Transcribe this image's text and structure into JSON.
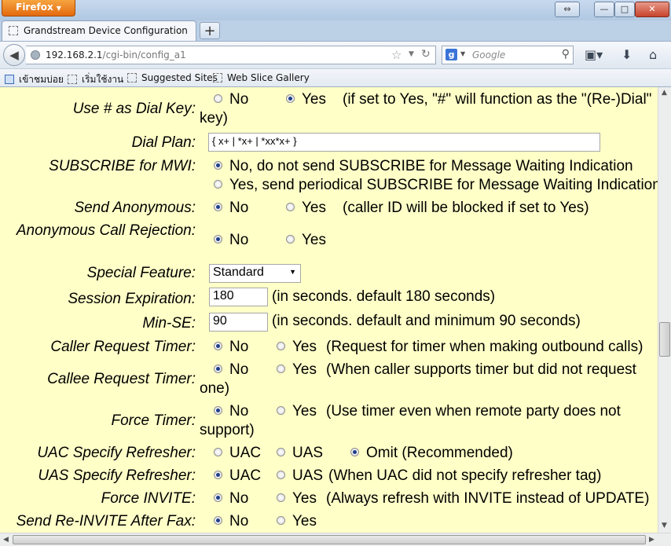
{
  "browser": {
    "menu_button": "Firefox",
    "tab_title": "Grandstream Device Configuration",
    "url_host": "192.168.2.1",
    "url_path": "/cgi-bin/config_a1",
    "search_placeholder": "Google",
    "search_engine_letter": "g",
    "bookmarks": [
      "เข้าชมบ่อย",
      "เริ่มใช้งาน",
      "Suggested Sites",
      "Web Slice Gallery"
    ]
  },
  "settings": {
    "dial_key": {
      "label": "Use # as Dial Key:",
      "opt_no": "No",
      "opt_yes": "Yes",
      "note": "(if set to Yes, \"#\" will function as the \"(Re-)Dial\"",
      "note_cont": "key)",
      "selected": "Yes"
    },
    "dial_plan": {
      "label": "Dial Plan:",
      "value": "{ x+ | *x+ | *xx*x+ }"
    },
    "subscribe_mwi": {
      "label": "SUBSCRIBE for MWI:",
      "opt_no": "No, do not send SUBSCRIBE for Message Waiting Indication",
      "opt_yes": "Yes, send periodical SUBSCRIBE for Message Waiting Indication",
      "selected": "No"
    },
    "send_anonymous": {
      "label": "Send Anonymous:",
      "opt_no": "No",
      "opt_yes": "Yes",
      "note": "(caller ID will be blocked if set to Yes)",
      "selected": "No"
    },
    "anon_rejection": {
      "label": "Anonymous Call Rejection:",
      "opt_no": "No",
      "opt_yes": "Yes",
      "selected": "No"
    },
    "special_feature": {
      "label": "Special Feature:",
      "value": "Standard"
    },
    "session_expiration": {
      "label": "Session Expiration:",
      "value": "180",
      "note": "(in seconds. default 180 seconds)"
    },
    "min_se": {
      "label": "Min-SE:",
      "value": "90",
      "note": "(in seconds. default and minimum 90 seconds)"
    },
    "caller_timer": {
      "label": "Caller Request Timer:",
      "opt_no": "No",
      "opt_yes": "Yes",
      "note": "(Request for timer when making outbound calls)",
      "selected": "No"
    },
    "callee_timer": {
      "label": "Callee Request Timer:",
      "opt_no": "No",
      "opt_yes": "Yes",
      "note": "(When caller supports timer but did not request",
      "note_cont": "one)",
      "selected": "No"
    },
    "force_timer": {
      "label": "Force Timer:",
      "opt_no": "No",
      "opt_yes": "Yes",
      "note": "(Use timer even when remote party does not",
      "note_cont": "support)",
      "selected": "No"
    },
    "uac_refresher": {
      "label": "UAC Specify Refresher:",
      "opt_uac": "UAC",
      "opt_uas": "UAS",
      "opt_omit": "Omit (Recommended)",
      "selected": "Omit"
    },
    "uas_refresher": {
      "label": "UAS Specify Refresher:",
      "opt_uac": "UAC",
      "opt_uas": "UAS",
      "note": "(When UAC did not specify refresher tag)",
      "selected": "UAC"
    },
    "force_invite": {
      "label": "Force INVITE:",
      "opt_no": "No",
      "opt_yes": "Yes",
      "note": "(Always refresh with INVITE instead of UPDATE)",
      "selected": "No"
    },
    "reinvite_fax": {
      "label": "Send Re-INVITE After Fax:",
      "opt_no": "No",
      "opt_yes": "Yes",
      "selected": "No"
    }
  }
}
